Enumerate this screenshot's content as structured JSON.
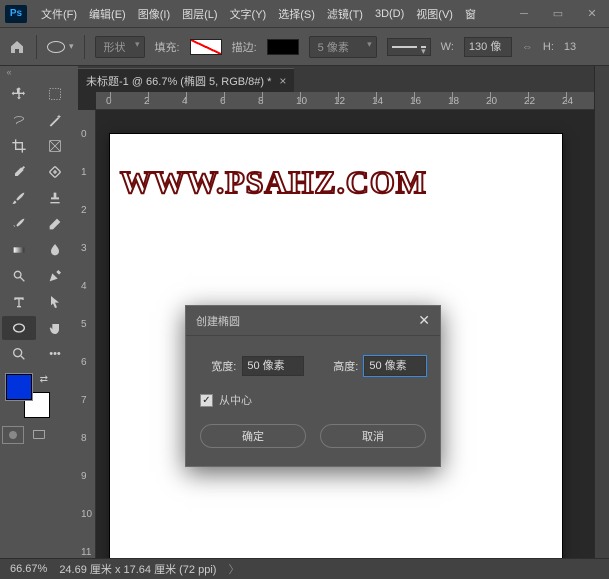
{
  "app": {
    "logo": "Ps"
  },
  "menu": [
    "文件(F)",
    "编辑(E)",
    "图像(I)",
    "图层(L)",
    "文字(Y)",
    "选择(S)",
    "滤镜(T)",
    "3D(D)",
    "视图(V)",
    "窗"
  ],
  "options": {
    "shape_mode": "形状",
    "fill_label": "填充:",
    "stroke_label": "描边:",
    "stroke_width": "5 像素",
    "w_label": "W:",
    "w_value": "130 像",
    "h_label": "H:",
    "h_value": "13"
  },
  "tab": {
    "title": "未标题-1 @ 66.7% (椭圆 5, RGB/8#) *"
  },
  "ruler_h": [
    0,
    2,
    4,
    6,
    8,
    10,
    12,
    14,
    16,
    18,
    20,
    22,
    24
  ],
  "ruler_v": [
    0,
    1,
    2,
    3,
    4,
    5,
    6,
    7,
    8,
    9,
    10,
    11
  ],
  "watermark": "WWW.PSAHZ.COM",
  "dialog": {
    "title": "创建椭圆",
    "width_label": "宽度:",
    "width_value": "50 像素",
    "height_label": "高度:",
    "height_value": "50 像素",
    "center_label": "从中心",
    "ok": "确定",
    "cancel": "取消"
  },
  "status": {
    "zoom": "66.67%",
    "dims": "24.69 厘米 x 17.64 厘米 (72 ppi)"
  },
  "colors": {
    "foreground": "#0033dd",
    "background": "#ffffff"
  }
}
